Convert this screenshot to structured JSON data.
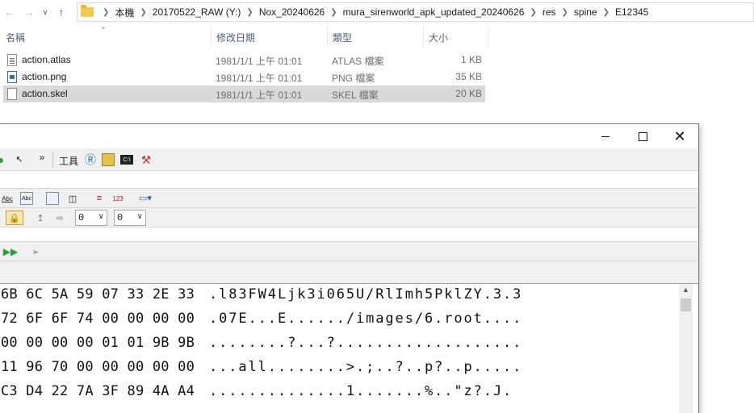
{
  "explorer": {
    "breadcrumbs": [
      "本機",
      "20170522_RAW (Y:)",
      "Nox_20240626",
      "mura_sirenworld_apk_updated_20240626",
      "res",
      "spine",
      "E12345"
    ],
    "columns": {
      "name": "名稱",
      "date": "修改日期",
      "type": "類型",
      "size": "大小"
    },
    "files": [
      {
        "name": "action.atlas",
        "date": "1981/1/1 上午 01:01",
        "type": "ATLAS 檔案",
        "size": "1 KB",
        "icon": "text-file-icon"
      },
      {
        "name": "action.png",
        "date": "1981/1/1 上午 01:01",
        "type": "PNG 檔案",
        "size": "35 KB",
        "icon": "image-file-icon"
      },
      {
        "name": "action.skel",
        "date": "1981/1/1 上午 01:01",
        "type": "SKEL 檔案",
        "size": "20 KB",
        "icon": "blank-file-icon",
        "selected": true
      }
    ]
  },
  "hex_editor": {
    "toolbar": {
      "tools_label": "工具",
      "overflow": "»",
      "select_a": "0",
      "select_b": "0"
    },
    "rows": [
      {
        "bytes": "6B 6C 5A 59 07 33 2E 33",
        "ascii": ".l83FW4Ljk3i065U/RlImh5PklZY.3.3"
      },
      {
        "bytes": "72 6F 6F 74 00 00 00 00",
        "ascii": ".07E...E....../images/6.root...."
      },
      {
        "bytes": "00 00 00 00 01 01 9B 9B",
        "ascii": "........?...?..................."
      },
      {
        "bytes": "11 96 70 00 00 00 00 00",
        "ascii": "...all........>.;..?..p?..p....."
      },
      {
        "bytes": "C3 D4 22 7A 3F 89 4A A4",
        "ascii": "..............1.......%..\"z?.J."
      }
    ]
  },
  "colors": {
    "selection": "#d9d9d9",
    "header_text": "#4d6082",
    "folder": "#f3c94f"
  }
}
